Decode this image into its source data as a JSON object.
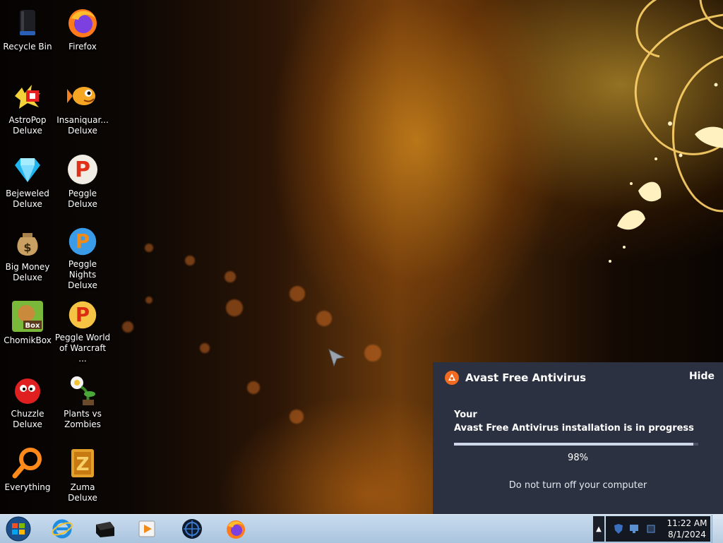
{
  "desktop_icons": [
    {
      "label": "Recycle Bin",
      "icon": "recycle-bin-icon"
    },
    {
      "label": "Firefox",
      "icon": "firefox-icon"
    },
    {
      "label": "AstroPop Deluxe",
      "icon": "astropop-icon"
    },
    {
      "label": "Insaniquar... Deluxe",
      "icon": "insaniquarium-icon"
    },
    {
      "label": "Bejeweled Deluxe",
      "icon": "bejeweled-icon"
    },
    {
      "label": "Peggle Deluxe",
      "icon": "peggle-icon"
    },
    {
      "label": "Big Money Deluxe",
      "icon": "big-money-icon"
    },
    {
      "label": "Peggle Nights Deluxe",
      "icon": "peggle-nights-icon"
    },
    {
      "label": "ChomikBox",
      "icon": "chomikbox-icon"
    },
    {
      "label": "Peggle World of Warcraft ...",
      "icon": "peggle-wow-icon"
    },
    {
      "label": "Chuzzle Deluxe",
      "icon": "chuzzle-icon"
    },
    {
      "label": "Plants vs Zombies",
      "icon": "plants-vs-zombies-icon"
    },
    {
      "label": "Everything",
      "icon": "everything-search-icon"
    },
    {
      "label": "Zuma Deluxe",
      "icon": "zuma-icon"
    }
  ],
  "popup": {
    "title": "Avast Free Antivirus",
    "hide_label": "Hide",
    "your_label": "Your",
    "message": "Avast Free Antivirus installation is in progress",
    "progress": 0.98,
    "percent_text": "98%",
    "note": "Do not turn off your computer"
  },
  "taskbar": {
    "items": [
      "start-orb-icon",
      "internet-explorer-icon",
      "terminal-icon",
      "media-player-icon",
      "network-globe-icon",
      "firefox-icon"
    ],
    "clock_time": "11:22 AM",
    "clock_date": "8/1/2024"
  },
  "colors": {
    "popup_bg": "#2b3140",
    "taskbar": "#b8cfe6",
    "avast_orange": "#f26b21"
  }
}
